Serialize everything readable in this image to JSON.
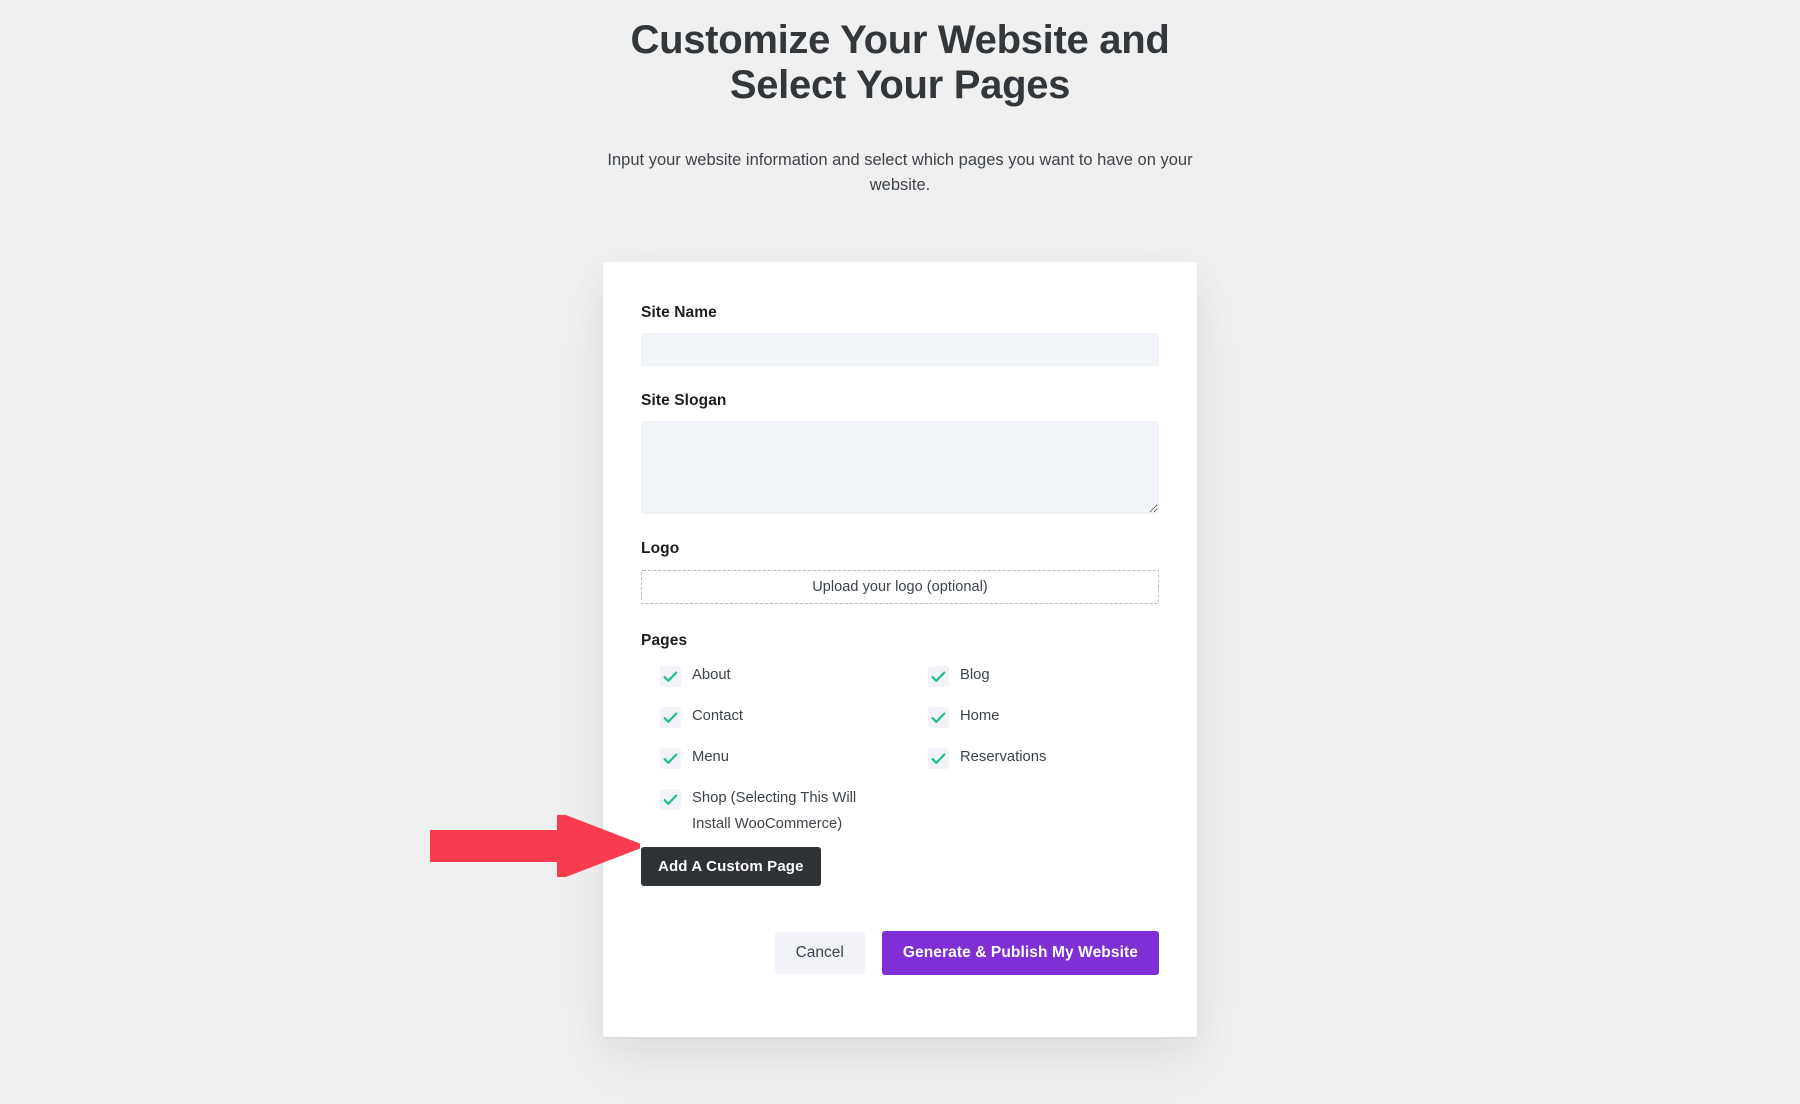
{
  "header": {
    "title": "Customize Your Website and Select Your Pages",
    "subtitle": "Input your website information and select which pages you want to have on your website."
  },
  "form": {
    "site_name": {
      "label": "Site Name",
      "value": "",
      "placeholder": ""
    },
    "site_slogan": {
      "label": "Site Slogan",
      "value": "",
      "placeholder": ""
    },
    "logo": {
      "label": "Logo",
      "upload_text": "Upload your logo (optional)"
    },
    "pages": {
      "label": "Pages",
      "options": [
        {
          "label": "About",
          "checked": true
        },
        {
          "label": "Blog",
          "checked": true
        },
        {
          "label": "Contact",
          "checked": true
        },
        {
          "label": "Home",
          "checked": true
        },
        {
          "label": "Menu",
          "checked": true
        },
        {
          "label": "Reservations",
          "checked": true
        },
        {
          "label": "Shop (Selecting This Will Install WooCommerce)",
          "checked": true
        }
      ]
    },
    "add_custom_page_label": "Add A Custom Page",
    "cancel_label": "Cancel",
    "submit_label": "Generate & Publish My Website"
  },
  "annotation": {
    "arrow_icon": "right-arrow-icon",
    "color": "#f93b4e",
    "points_to": "Shop (Selecting This Will Install WooCommerce)"
  },
  "colors": {
    "page_background": "#f0f0f0",
    "card_background": "#ffffff",
    "input_background": "#f1f4f8",
    "checkbox_background": "#f2f3f8",
    "checkmark": "#1fc08a",
    "primary_button": "#7f2fd4",
    "dark_button": "#2f3337",
    "cancel_button": "#f2f3f8",
    "heading_text": "#32373c",
    "body_text": "#3c434a",
    "annotation_red": "#f93b4e"
  }
}
